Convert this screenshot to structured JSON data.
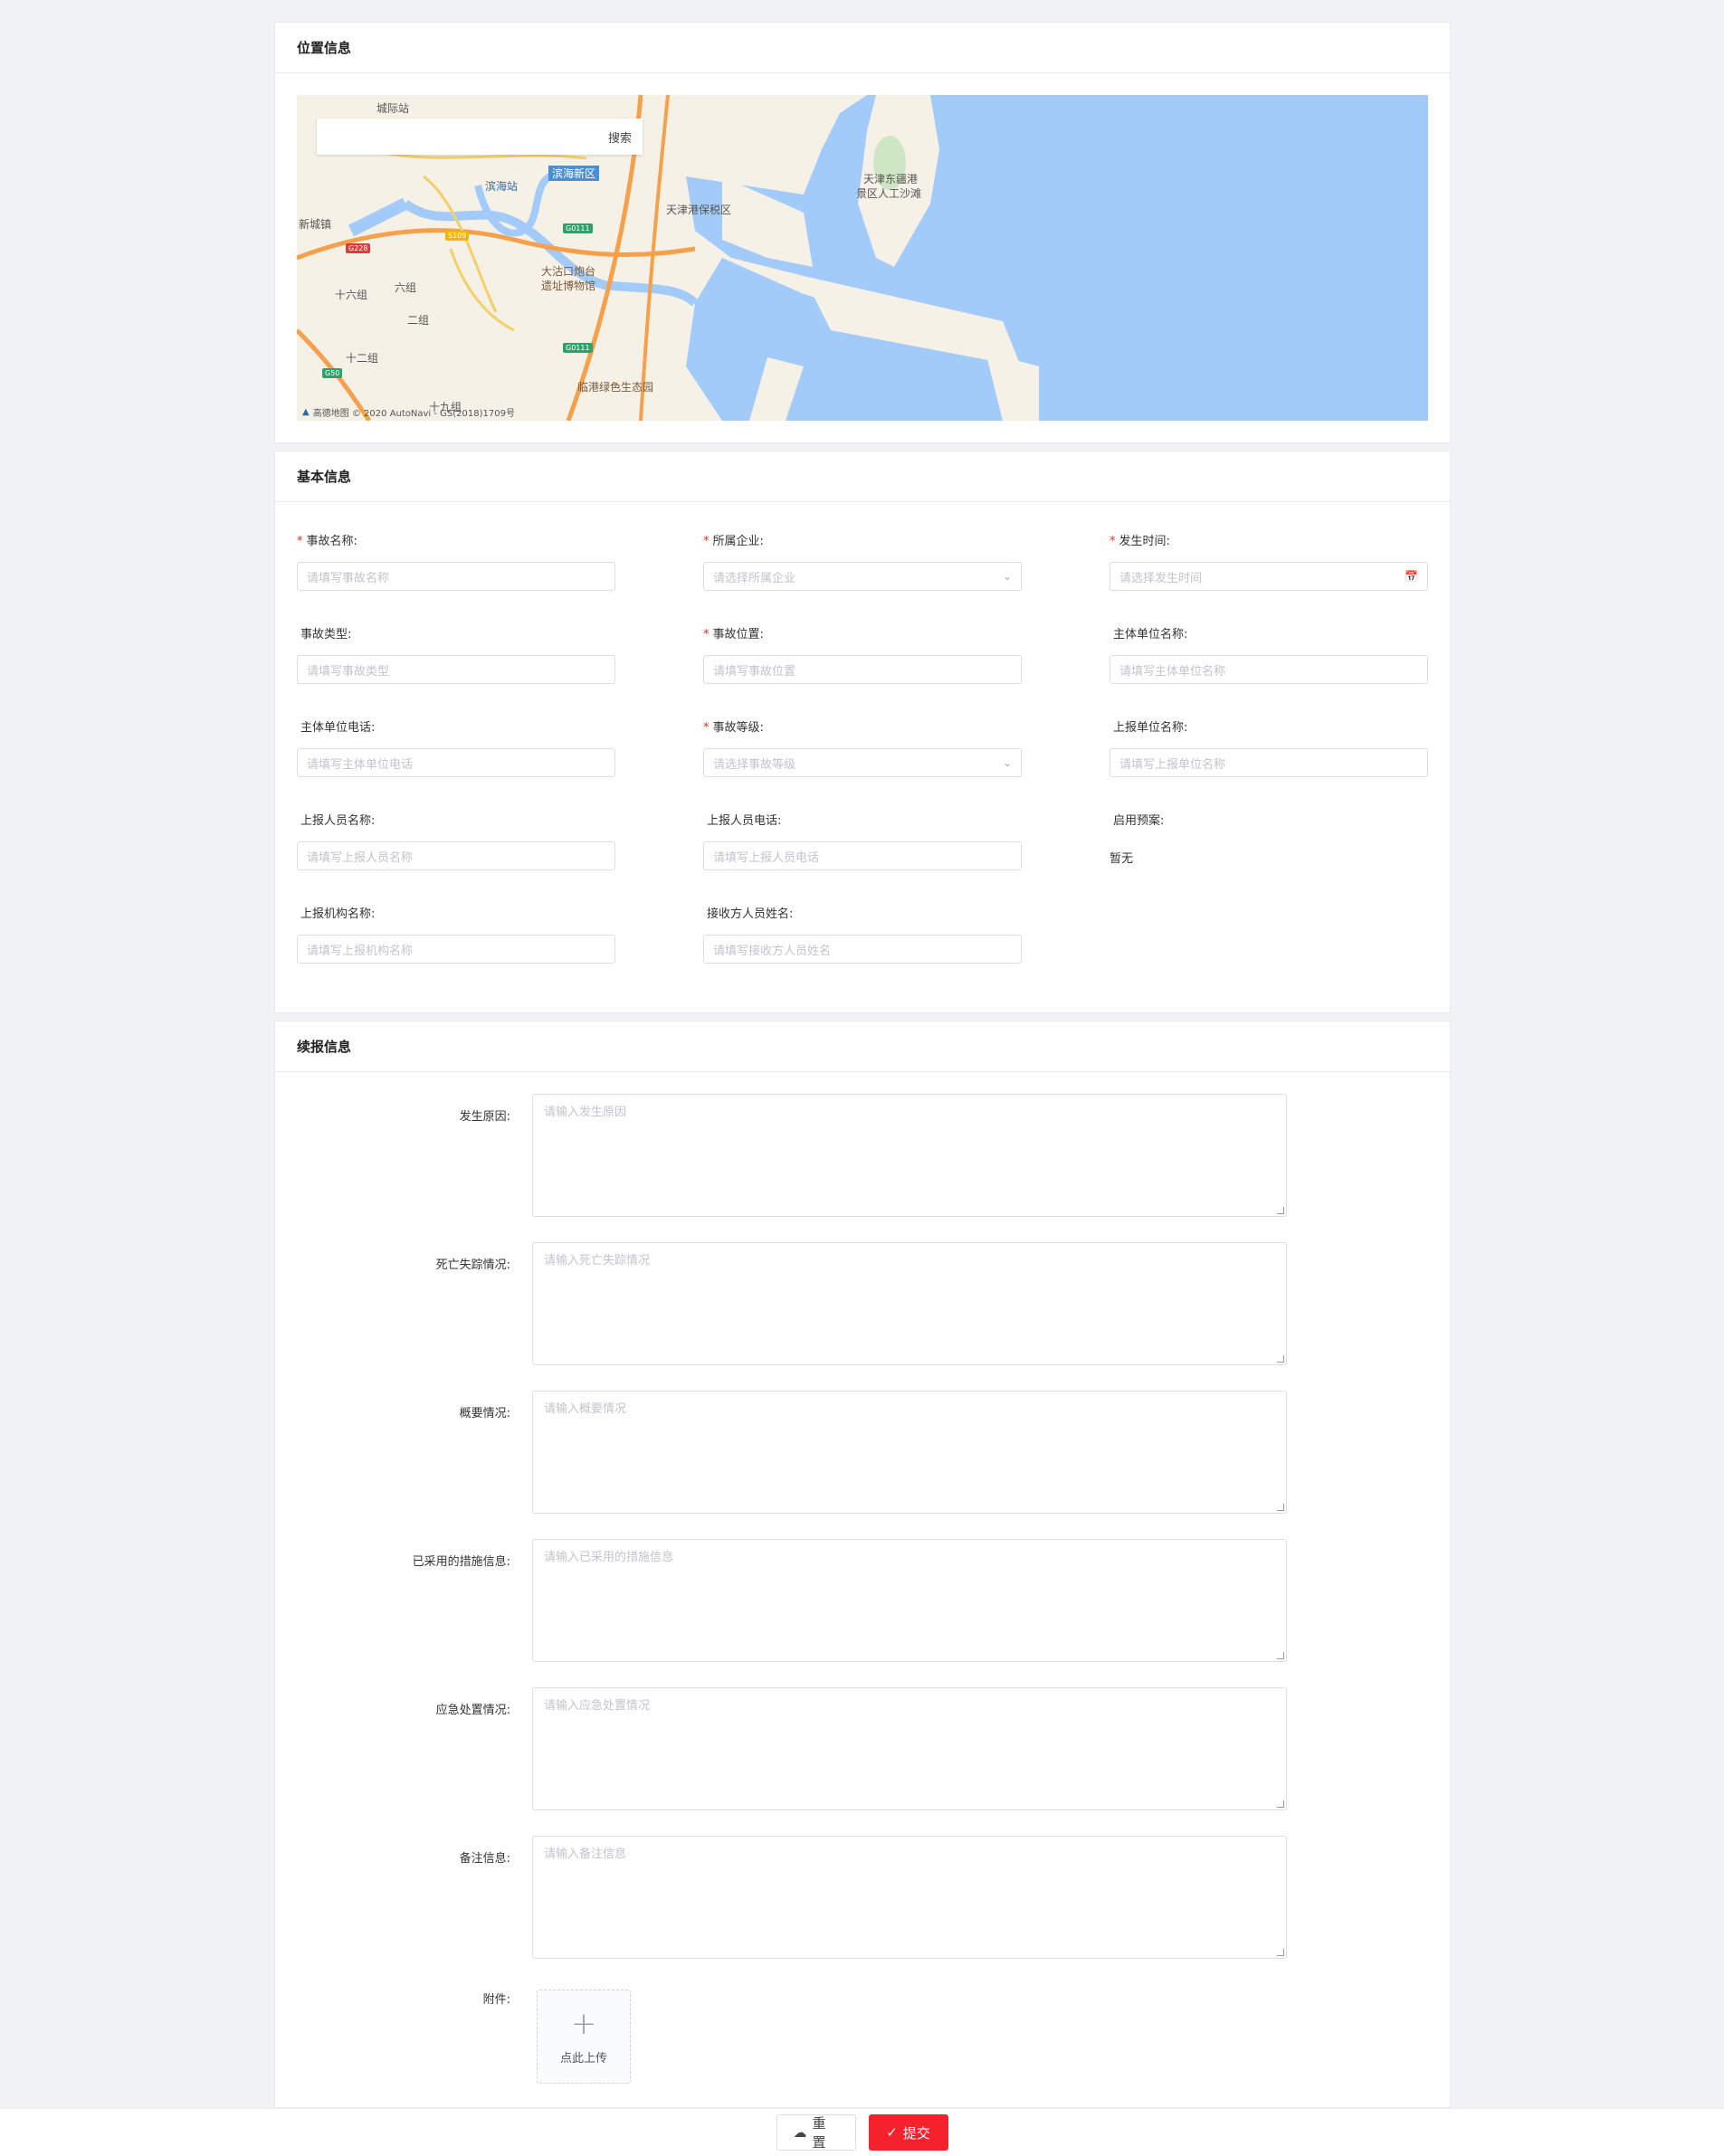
{
  "sections": {
    "location": {
      "title": "位置信息"
    },
    "basic": {
      "title": "基本信息"
    },
    "followup": {
      "title": "续报信息"
    }
  },
  "map": {
    "search_placeholder": "",
    "search_button": "搜索",
    "copyright": "高德地图 © 2020 AutoNavi - GS(2018)1709号",
    "labels": {
      "chengjizhan": "城际站",
      "binhaizhan": "滨海站",
      "binhaixinqu": "滨海新区",
      "tianjingang": "天津港保税区",
      "dongjiang": "天津东疆港",
      "renggong": "景区人工沙滩",
      "xinchengzhen": "新城镇",
      "dagukou": "大沽口炮台",
      "yizhi": "遗址博物馆",
      "shiliuzu": "十六组",
      "liuzu": "六组",
      "erzu": "二组",
      "shierzu": "十二组",
      "shijiuzu": "十九组",
      "lingang": "临港绿色生态园"
    },
    "badges": {
      "g228": "G228",
      "s109": "S109",
      "g0111a": "G0111",
      "g0111b": "G0111",
      "g50": "G50"
    }
  },
  "basic_fields": [
    {
      "label": "事故名称:",
      "required": "*",
      "placeholder": "请填写事故名称"
    },
    {
      "label": "所属企业:",
      "required": "*",
      "placeholder": "请选择所属企业"
    },
    {
      "label": "发生时间:",
      "required": "*",
      "placeholder": "请选择发生时间"
    },
    {
      "label": "事故类型:",
      "required": "",
      "placeholder": "请填写事故类型"
    },
    {
      "label": "事故位置:",
      "required": "*",
      "placeholder": "请填写事故位置"
    },
    {
      "label": "主体单位名称:",
      "required": "",
      "placeholder": "请填写主体单位名称"
    },
    {
      "label": "主体单位电话:",
      "required": "",
      "placeholder": "请填写主体单位电话"
    },
    {
      "label": "事故等级:",
      "required": "*",
      "placeholder": "请选择事故等级"
    },
    {
      "label": "上报单位名称:",
      "required": "",
      "placeholder": "请填写上报单位名称"
    },
    {
      "label": "上报人员名称:",
      "required": "",
      "placeholder": "请填写上报人员名称"
    },
    {
      "label": "上报人员电话:",
      "required": "",
      "placeholder": "请填写上报人员电话"
    },
    {
      "label": "启用预案:",
      "required": "",
      "value": "暂无"
    },
    {
      "label": "上报机构名称:",
      "required": "",
      "placeholder": "请填写上报机构名称"
    },
    {
      "label": "接收方人员姓名:",
      "required": "",
      "placeholder": "请填写接收方人员姓名"
    }
  ],
  "followup_fields": [
    {
      "label": "发生原因:",
      "placeholder": "请输入发生原因"
    },
    {
      "label": "死亡失踪情况:",
      "placeholder": "请输入死亡失踪情况"
    },
    {
      "label": "概要情况:",
      "placeholder": "请输入概要情况"
    },
    {
      "label": "已采用的措施信息:",
      "placeholder": "请输入已采用的措施信息"
    },
    {
      "label": "应急处置情况:",
      "placeholder": "请输入应急处置情况"
    },
    {
      "label": "备注信息:",
      "placeholder": "请输入备注信息"
    }
  ],
  "attachment": {
    "label": "附件:",
    "upload_text": "点此上传",
    "plus": "+"
  },
  "footer": {
    "reset_label": "重置",
    "submit_label": "提交"
  },
  "icons": {
    "select": "chevron-down-icon",
    "date": "calendar-icon",
    "reset": "cloud-icon",
    "submit": "check-icon"
  },
  "colors": {
    "accent": "#f5222d",
    "sea": "#a3cbf9",
    "land": "#f6f1e7",
    "road": "#f5a04a"
  }
}
